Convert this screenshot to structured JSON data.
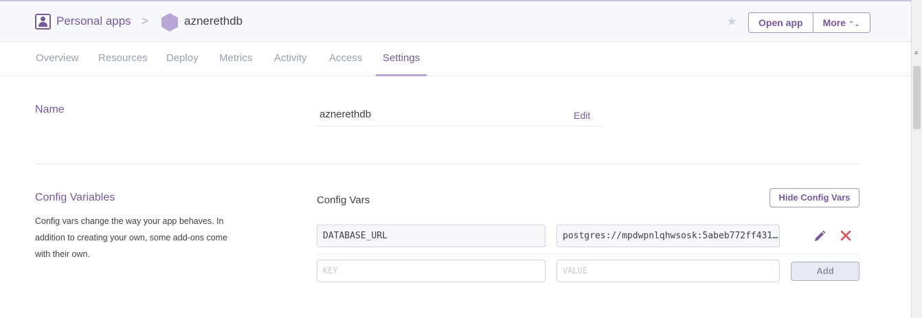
{
  "header": {
    "breadcrumb_root": "Personal apps",
    "breadcrumb_separator": ">",
    "app_name": "aznerethdb",
    "open_app_label": "Open app",
    "more_label": "More",
    "more_caret": "⌃⌄",
    "star_icon": "star-icon",
    "star_glyph": "★"
  },
  "tabs": [
    {
      "label": "Overview"
    },
    {
      "label": "Resources"
    },
    {
      "label": "Deploy"
    },
    {
      "label": "Metrics"
    },
    {
      "label": "Activity"
    },
    {
      "label": "Access"
    },
    {
      "label": "Settings",
      "active": true
    }
  ],
  "name_section": {
    "title": "Name",
    "value": "aznerethdb",
    "edit_label": "Edit"
  },
  "config_section": {
    "title": "Config Variables",
    "description": "Config vars change the way your app behaves. In addition to creating your own, some add-ons come with their own.",
    "heading": "Config Vars",
    "hide_label": "Hide Config Vars",
    "vars": [
      {
        "key": "DATABASE_URL",
        "value": "postgres://mpdwpnlqhwsosk:5abeb772ff431…"
      }
    ],
    "new_key_placeholder": "KEY",
    "new_value_placeholder": "VALUE",
    "add_label": "Add"
  },
  "colors": {
    "accent": "#79589f",
    "tab_inactive": "#96a0b5",
    "delete": "#e5484d"
  },
  "scrollbar_grip": "≡"
}
